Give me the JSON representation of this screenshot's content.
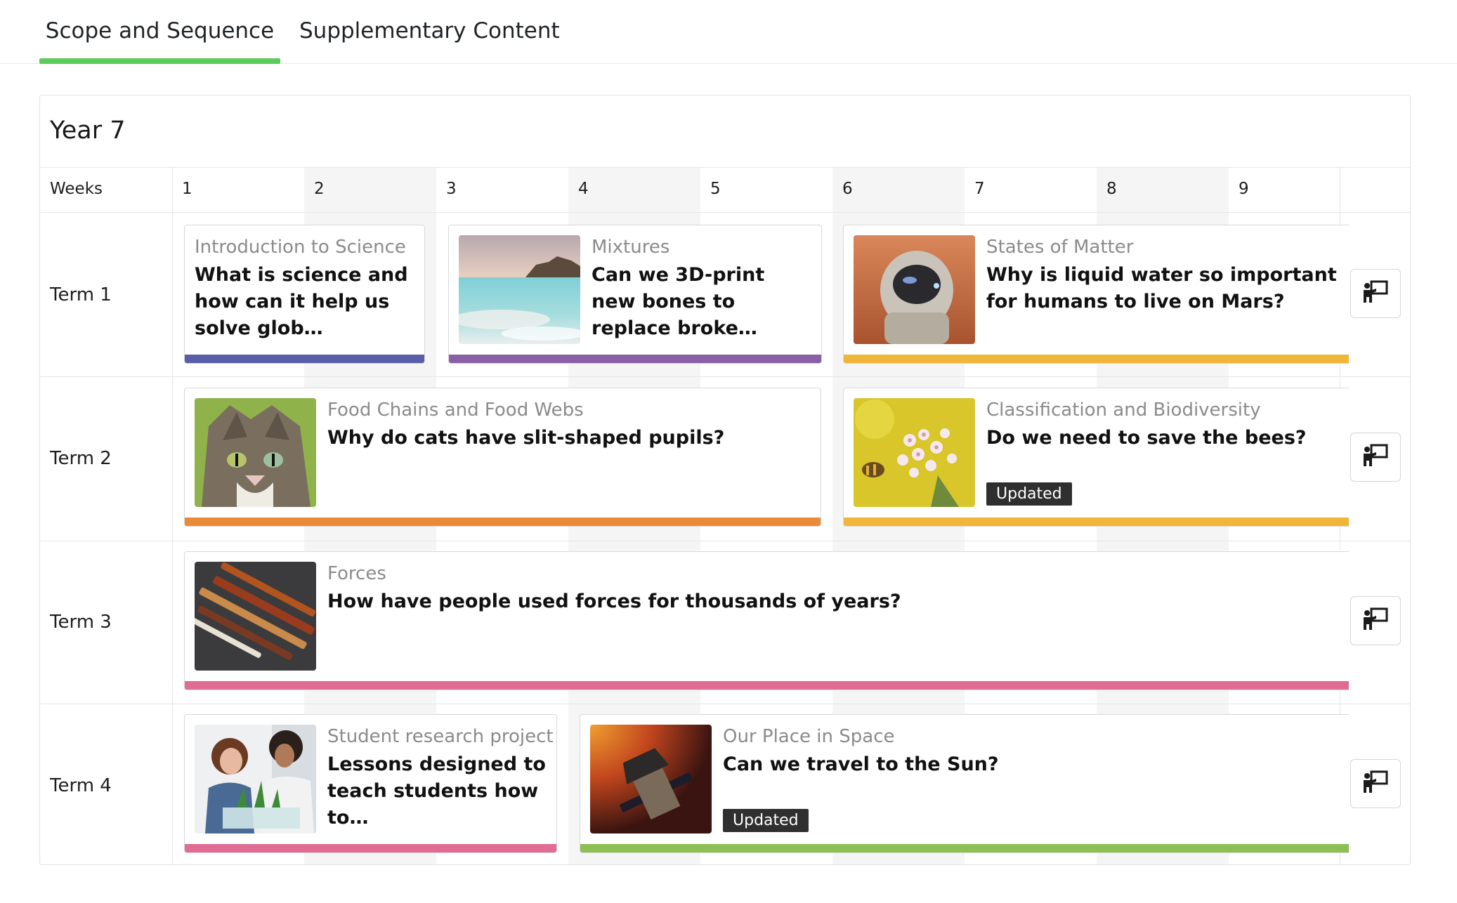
{
  "tabs": [
    {
      "label": "Scope and Sequence",
      "active": true
    },
    {
      "label": "Supplementary Content",
      "active": false
    }
  ],
  "colors": {
    "tab_active_underline": "#5bcc5b",
    "intro_science": "#5a5ea8",
    "mixtures": "#8a5fa6",
    "states_of_matter": "#f0b63a",
    "food_chains": "#ea8b3a",
    "classification": "#f0b63a",
    "forces": "#e06b93",
    "student_research": "#e06b93",
    "our_place_in_space": "#8ebf55",
    "updated_badge": "#2f2f2f"
  },
  "year": {
    "title": "Year 7"
  },
  "weeks": {
    "label": "Weeks",
    "numbers": [
      "1",
      "2",
      "3",
      "4",
      "5",
      "6",
      "7",
      "8",
      "9"
    ]
  },
  "terms": [
    {
      "label": "Term 1",
      "cards": [
        {
          "unit": "Introduction to Science",
          "question": "What is science and how can it help us solve glob…",
          "image": "none"
        },
        {
          "unit": "Mixtures",
          "question": "Can we 3D-print new bones to replace broke…",
          "image": "salt-lake-photo"
        },
        {
          "unit": "States of Matter",
          "question": "Why is liquid water so important for humans to live on Mars?",
          "image": "astronaut-on-mars-photo"
        }
      ]
    },
    {
      "label": "Term 2",
      "cards": [
        {
          "unit": "Food Chains and Food Webs",
          "question": "Why do cats have slit-shaped pupils?",
          "image": "cat-photo"
        },
        {
          "unit": "Classification and Biodiversity",
          "question": "Do we need to save the bees?",
          "image": "bee-on-flower-photo",
          "badge": "Updated"
        }
      ]
    },
    {
      "label": "Term 3",
      "cards": [
        {
          "unit": "Forces",
          "question": "How have people used forces for thousands of years?",
          "image": "ancient-tools-photo"
        }
      ]
    },
    {
      "label": "Term 4",
      "cards": [
        {
          "unit": "Student research project",
          "question": "Lessons designed to teach students how to…",
          "image": "students-with-plants-photo"
        },
        {
          "unit": "Our Place in Space",
          "question": "Can we travel to the Sun?",
          "image": "solar-probe-photo",
          "badge": "Updated"
        }
      ]
    }
  ],
  "teach_button_icon": "presenter-icon"
}
